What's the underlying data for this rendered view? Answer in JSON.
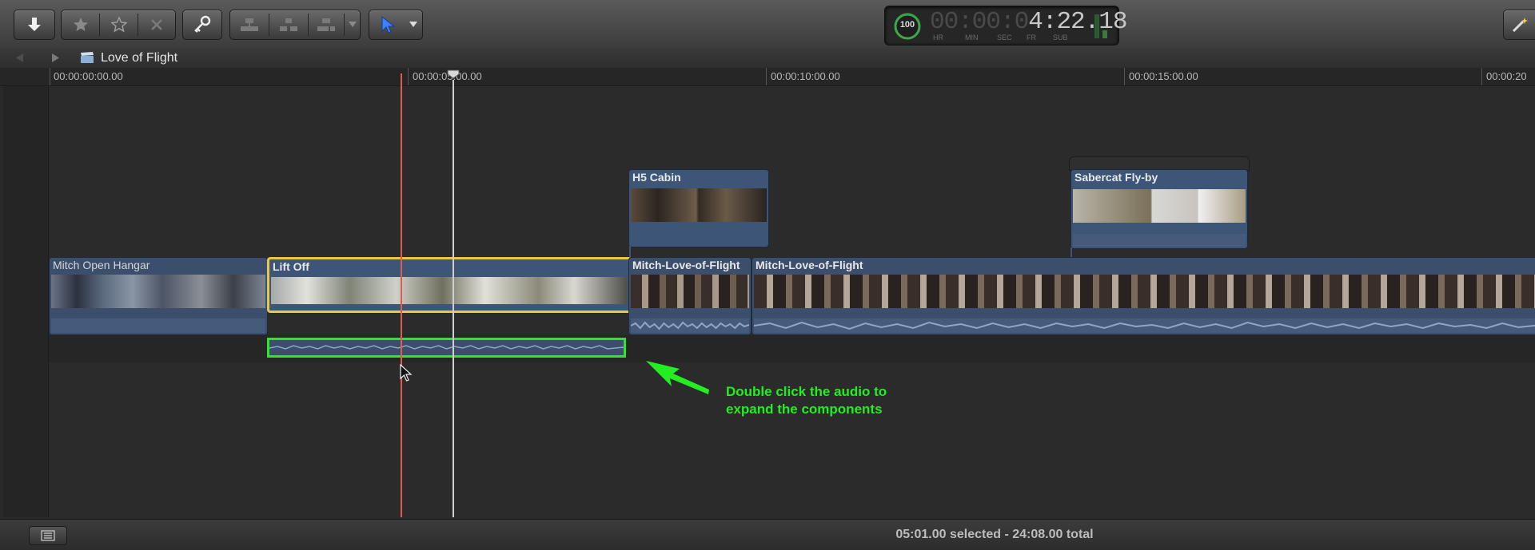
{
  "project": {
    "title": "Love of Flight"
  },
  "timecode": {
    "percent": "100",
    "dim": "00:00:0",
    "bright": "4:22.18",
    "units": [
      "HR",
      "MIN",
      "SEC",
      "FR",
      "SUB"
    ]
  },
  "ruler": {
    "labels": [
      "00:00:00:00.00",
      "00:00:05:00.00",
      "00:00:10:00.00",
      "00:00:15:00.00",
      "00:00:20"
    ]
  },
  "clips": {
    "mitch_open_hangar": "Mitch Open Hangar",
    "lift_off": "Lift Off",
    "h5_cabin": "H5 Cabin",
    "sabercat": "Sabercat Fly-by",
    "mitch_love_a": "Mitch-Love-of-Flight",
    "mitch_love_b": "Mitch-Love-of-Flight"
  },
  "annotation": {
    "line1": "Double click the audio to",
    "line2": "expand the components",
    "color": "#22ee22"
  },
  "status": {
    "selection": "05:01.00 selected - 24:08.00 total"
  },
  "colors": {
    "selected_clip": "#e8c84a",
    "playhead": "#e35b4a",
    "audio_highlight": "#22ee22",
    "tool_accent": "#3d7fff"
  }
}
